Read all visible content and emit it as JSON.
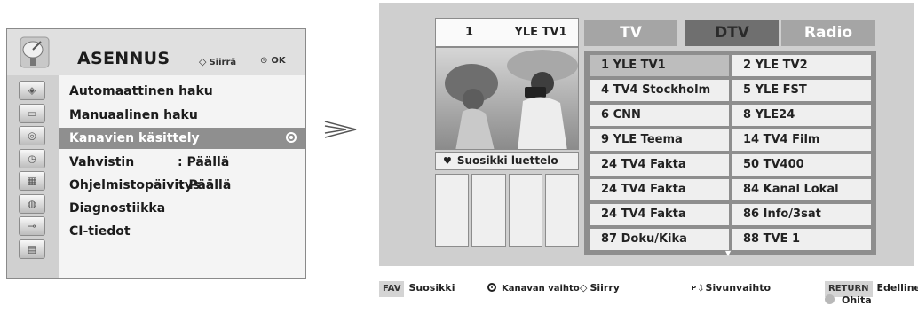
{
  "menu": {
    "title": "ASENNUS",
    "hint_move": "Siirrä",
    "hint_ok": "OK",
    "side_icons": [
      "satellite-dish-icon",
      "antenna-icon",
      "screen-icon",
      "disc-icon",
      "clock-icon",
      "lock-calendar-icon",
      "padlock-icon",
      "plug-icon",
      "card-icon"
    ],
    "items": [
      {
        "label": "Automaattinen haku",
        "value": ""
      },
      {
        "label": "Manuaalinen haku",
        "value": ""
      },
      {
        "label": "Kanavien käsittely",
        "value": "",
        "selected": true
      },
      {
        "label": "Vahvistin",
        "value": ": Päällä"
      },
      {
        "label": "Ohjelmistopäivitys",
        "value": ": Päällä"
      },
      {
        "label": "Diagnostiikka",
        "value": ""
      },
      {
        "label": "CI-tiedot",
        "value": ""
      }
    ]
  },
  "editor": {
    "channel_number": "1",
    "channel_name": "YLE TV1",
    "favourites_label": "Suosikki luettelo",
    "tabs": [
      {
        "label": "TV"
      },
      {
        "label": "DTV",
        "active": true
      },
      {
        "label": "Radio"
      }
    ],
    "channels": [
      "1 YLE TV1",
      "2 YLE TV2",
      "4 TV4 Stockholm",
      "5 YLE FST",
      "6 CNN",
      "8 YLE24",
      "9 YLE Teema",
      "14 TV4 Film",
      "24 TV4 Fakta",
      "50 TV400",
      "24 TV4 Fakta",
      "84 Kanal Lokal",
      "24 TV4 Fakta",
      "86 Info/3sat",
      "87 Doku/Kika",
      "88 TVE 1"
    ]
  },
  "legend": {
    "fav_key": "FAV",
    "fav_label": "Suosikki",
    "change_label": "Kanavan vaihto",
    "move_label": "Siirry",
    "page_key": "P",
    "page_label": "Sivunvaihto",
    "return_key": "RETURN",
    "return_label": "Edellinen",
    "skip_label": "Ohita"
  }
}
